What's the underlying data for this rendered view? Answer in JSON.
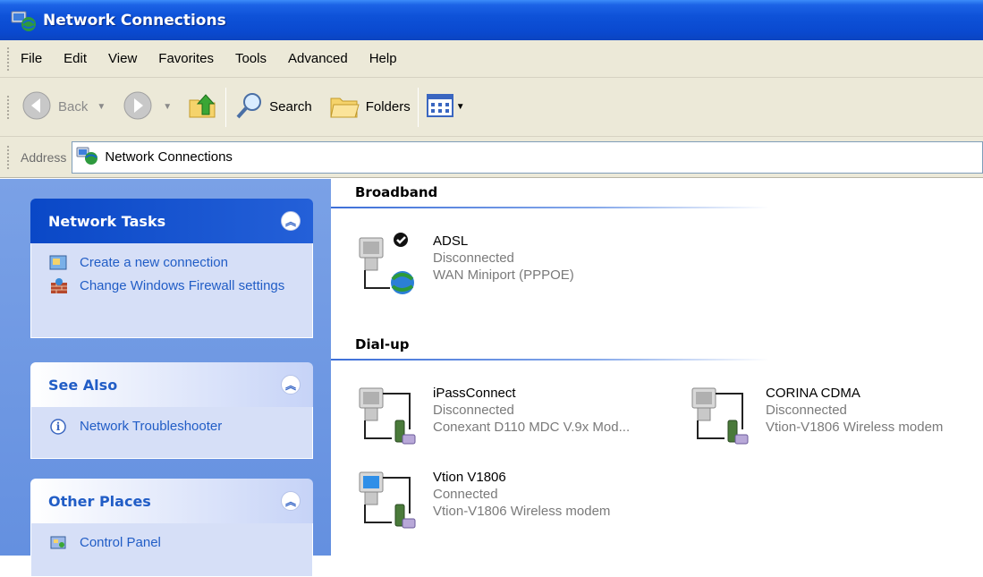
{
  "window": {
    "title": "Network Connections"
  },
  "menu": [
    "File",
    "Edit",
    "View",
    "Favorites",
    "Tools",
    "Advanced",
    "Help"
  ],
  "toolbar": {
    "back": "Back",
    "search": "Search",
    "folders": "Folders"
  },
  "address": {
    "label": "Address",
    "value": "Network Connections"
  },
  "sidebar": {
    "network_tasks": {
      "title": "Network Tasks",
      "items": [
        "Create a new connection",
        "Change Windows Firewall settings"
      ]
    },
    "see_also": {
      "title": "See Also",
      "items": [
        "Network Troubleshooter"
      ]
    },
    "other_places": {
      "title": "Other Places",
      "items": [
        "Control Panel"
      ]
    }
  },
  "groups": {
    "broadband": {
      "title": "Broadband",
      "connections": [
        {
          "name": "ADSL",
          "status": "Disconnected",
          "device": "WAN Miniport (PPPOE)"
        }
      ]
    },
    "dialup": {
      "title": "Dial-up",
      "connections": [
        {
          "name": "iPassConnect",
          "status": "Disconnected",
          "device": "Conexant D110 MDC V.9x Mod..."
        },
        {
          "name": "CORINA CDMA",
          "status": "Disconnected",
          "device": "Vtion-V1806 Wireless modem"
        },
        {
          "name": "Vtion V1806",
          "status": "Connected",
          "device": "Vtion-V1806 Wireless modem"
        }
      ]
    }
  },
  "colors": {
    "title_blue": "#0a49cf",
    "link_blue": "#215dc6",
    "pane_blue": "#6d97e3"
  }
}
